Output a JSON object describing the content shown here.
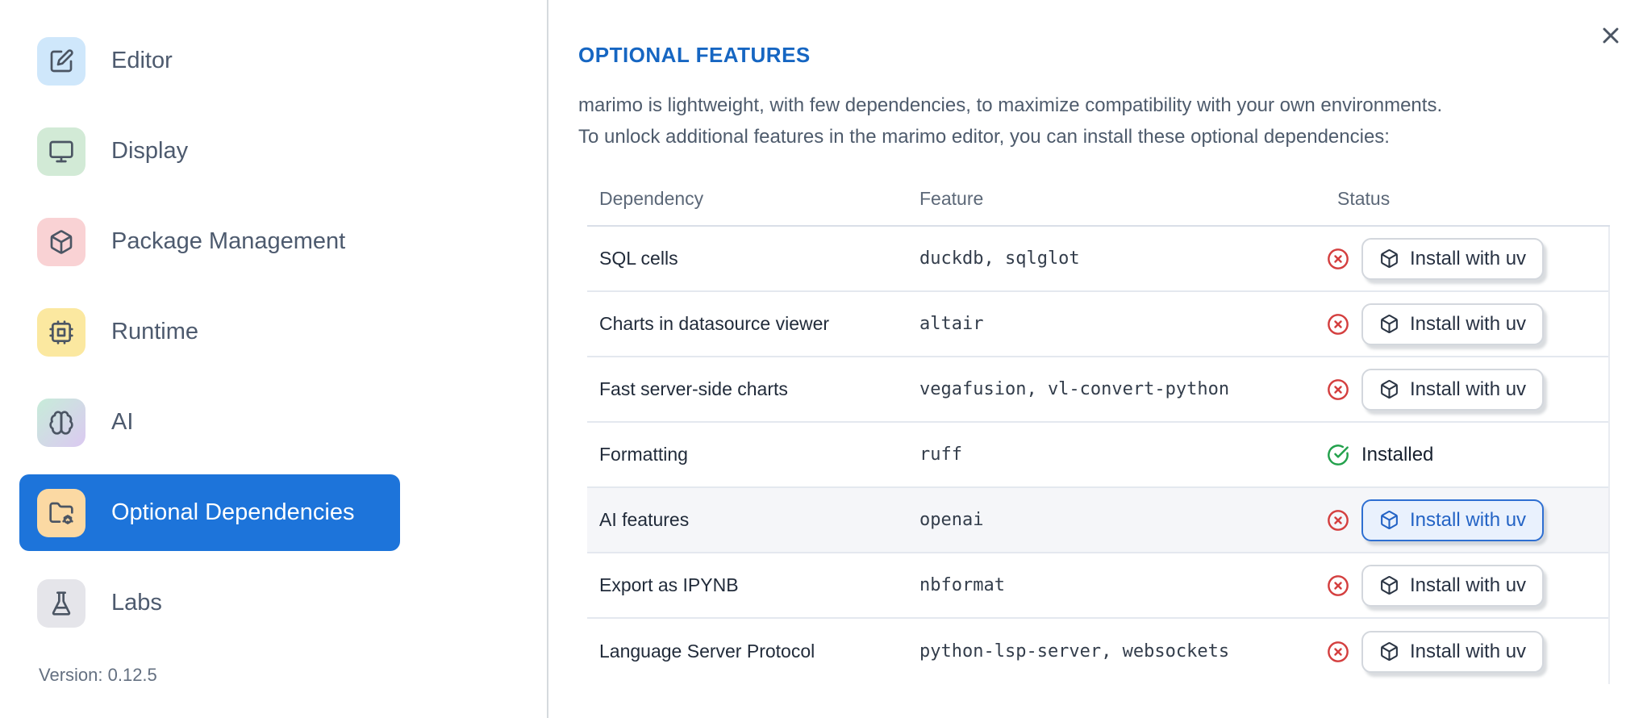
{
  "sidebar": {
    "items": [
      {
        "label": "Editor",
        "icon": "square-pen-icon",
        "icon_bg": "#cfe7fb",
        "selected": false
      },
      {
        "label": "Display",
        "icon": "monitor-icon",
        "icon_bg": "#d2ead6",
        "selected": false
      },
      {
        "label": "Package Management",
        "icon": "box-icon",
        "icon_bg": "#f9d2d4",
        "selected": false
      },
      {
        "label": "Runtime",
        "icon": "cpu-icon",
        "icon_bg": "#fbe8a0",
        "selected": false
      },
      {
        "label": "AI",
        "icon": "brain-icon",
        "icon_bg": "linear-gradient(#c7ecd9,#dbc9f1)",
        "selected": false
      },
      {
        "label": "Optional Dependencies",
        "icon": "folder-cog-icon",
        "icon_bg": "#fbd9a3",
        "selected": true
      },
      {
        "label": "Labs",
        "icon": "flask-icon",
        "icon_bg": "#e5e5ea",
        "selected": false
      }
    ],
    "version_label": "Version: 0.12.5"
  },
  "panel": {
    "title": "OPTIONAL FEATURES",
    "description_line1": "marimo is lightweight, with few dependencies, to maximize compatibility with your own environments.",
    "description_line2": "To unlock additional features in the marimo editor, you can install these optional dependencies:",
    "close_icon": "x-icon"
  },
  "table": {
    "headers": {
      "dependency": "Dependency",
      "feature": "Feature",
      "status": "Status"
    },
    "install_button_label": "Install with uv",
    "installed_label": "Installed",
    "rows": [
      {
        "dependency": "SQL cells",
        "feature": "duckdb, sqlglot",
        "status": "not_installed"
      },
      {
        "dependency": "Charts in datasource viewer",
        "feature": "altair",
        "status": "not_installed"
      },
      {
        "dependency": "Fast server-side charts",
        "feature": "vegafusion, vl-convert-python",
        "status": "not_installed"
      },
      {
        "dependency": "Formatting",
        "feature": "ruff",
        "status": "installed"
      },
      {
        "dependency": "AI features",
        "feature": "openai",
        "status": "not_installed",
        "highlighted": true
      },
      {
        "dependency": "Export as IPYNB",
        "feature": "nbformat",
        "status": "not_installed"
      },
      {
        "dependency": "Language Server Protocol",
        "feature": "python-lsp-server, websockets",
        "status": "not_installed"
      }
    ]
  },
  "colors": {
    "accent_blue": "#1d74da",
    "title_blue": "#1666c2",
    "status_error_red": "#d43f3f",
    "status_ok_green": "#23a14c",
    "primary_button_blue": "#2e6fd2"
  }
}
